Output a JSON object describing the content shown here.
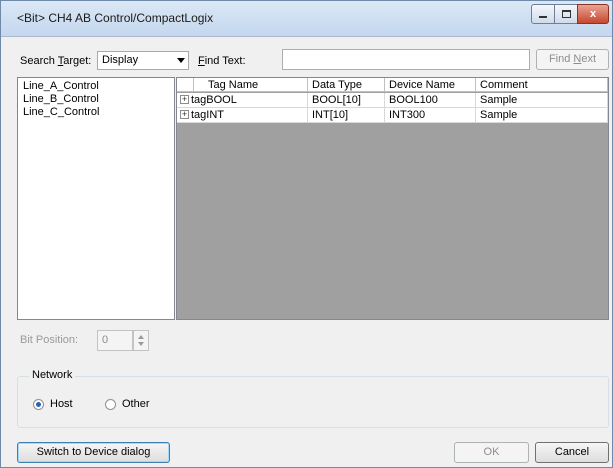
{
  "window": {
    "title": "<Bit> CH4 AB Control/CompactLogix",
    "close_glyph": "x"
  },
  "toolbar": {
    "search_target_prefix": "Search ",
    "search_target_hotkey": "T",
    "search_target_suffix": "arget:",
    "search_target_value": "Display",
    "find_text_hotkey": "F",
    "find_text_suffix": "ind Text:",
    "find_text_value": "",
    "find_next_prefix": "Find ",
    "find_next_hotkey": "N",
    "find_next_suffix": "ext"
  },
  "controllers": [
    "Line_A_Control",
    "Line_B_Control",
    "Line_C_Control"
  ],
  "tag_table": {
    "columns": [
      "Tag Name",
      "Data Type",
      "Device Name",
      "Comment"
    ],
    "expander_glyph": "+",
    "rows": [
      {
        "tag": "tagBOOL",
        "type": "BOOL[10]",
        "device": "BOOL100",
        "comment": "Sample"
      },
      {
        "tag": "tagINT",
        "type": "INT[10]",
        "device": "INT300",
        "comment": "Sample"
      }
    ]
  },
  "bit_position": {
    "label": "Bit Position:",
    "value": "0"
  },
  "network": {
    "title": "Network",
    "options": [
      {
        "label": "Host",
        "selected": true
      },
      {
        "label": "Other",
        "selected": false
      }
    ]
  },
  "footer": {
    "switch_label": "Switch to Device dialog",
    "ok_label": "OK",
    "cancel_label": "Cancel"
  }
}
